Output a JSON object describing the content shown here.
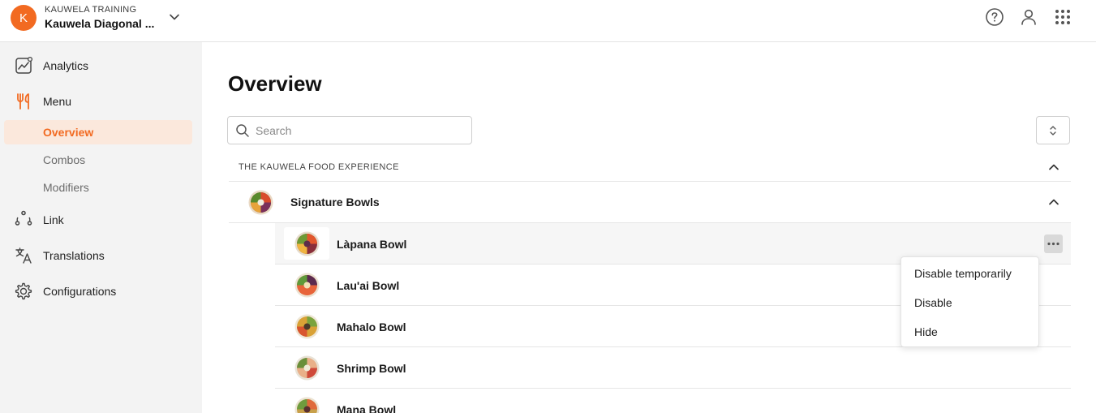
{
  "header": {
    "avatar_letter": "K",
    "org_subtitle": "KAUWELA TRAINING",
    "org_name": "Kauwela Diagonal ...",
    "icons": [
      "help-icon",
      "user-icon",
      "apps-grid-icon"
    ]
  },
  "sidebar": {
    "items": [
      {
        "label": "Analytics",
        "icon": "analytics-icon"
      },
      {
        "label": "Menu",
        "icon": "fork-knife-icon"
      },
      {
        "label": "Link",
        "icon": "link-icon"
      },
      {
        "label": "Translations",
        "icon": "translate-icon"
      },
      {
        "label": "Configurations",
        "icon": "gear-icon"
      }
    ],
    "menu_subitems": [
      {
        "label": "Overview",
        "active": true
      },
      {
        "label": "Combos",
        "active": false
      },
      {
        "label": "Modifiers",
        "active": false
      }
    ]
  },
  "main": {
    "title": "Overview",
    "search_placeholder": "Search",
    "section_title": "THE KAUWELA FOOD EXPERIENCE",
    "category_title": "Signature Bowls",
    "items": [
      {
        "label": "Làpana Bowl"
      },
      {
        "label": "Lau'ai Bowl"
      },
      {
        "label": "Mahalo Bowl"
      },
      {
        "label": "Shrimp Bowl"
      },
      {
        "label": "Mana Bowl"
      }
    ]
  },
  "dropdown": {
    "items": [
      {
        "label": "Disable temporarily"
      },
      {
        "label": "Disable"
      },
      {
        "label": "Hide"
      }
    ]
  },
  "colors": {
    "accent": "#f26a21",
    "active_bg": "#fbe8dc",
    "sidebar_bg": "#f3f3f3"
  }
}
